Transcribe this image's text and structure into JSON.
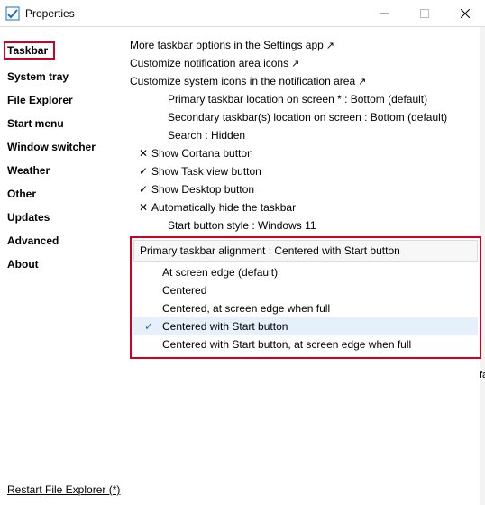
{
  "window": {
    "title": "Properties"
  },
  "sidebar": {
    "items": [
      {
        "label": "Taskbar",
        "active": true
      },
      {
        "label": "System tray"
      },
      {
        "label": "File Explorer"
      },
      {
        "label": "Start menu"
      },
      {
        "label": "Window switcher"
      },
      {
        "label": "Weather"
      },
      {
        "label": "Other"
      },
      {
        "label": "Updates"
      },
      {
        "label": "Advanced"
      },
      {
        "label": "About"
      }
    ]
  },
  "main": {
    "links": {
      "more_settings": "More taskbar options in the Settings app",
      "customize_notif": "Customize notification area icons",
      "customize_sys_icons": "Customize system icons in the notification area"
    },
    "settings": {
      "primary_location": "Primary taskbar location on screen * : Bottom (default)",
      "secondary_location": "Secondary taskbar(s) location on screen : Bottom (default)",
      "search": "Search : Hidden",
      "cortana": "Show Cortana button",
      "taskview": "Show Task view button",
      "desktop": "Show Desktop button",
      "autohide": "Automatically hide the taskbar",
      "start_style": "Start button style : Windows 11"
    },
    "alignment_panel": {
      "header": "Primary taskbar alignment : Centered with Start button",
      "options": [
        "At screen edge (default)",
        "Centered",
        "Centered, at screen edge when full",
        "Centered with Start button",
        "Centered with Start button, at screen edge when full"
      ],
      "selected_index": 3
    }
  },
  "footer": {
    "restart": "Restart File Explorer (*)"
  },
  "sliver_char": "fa"
}
